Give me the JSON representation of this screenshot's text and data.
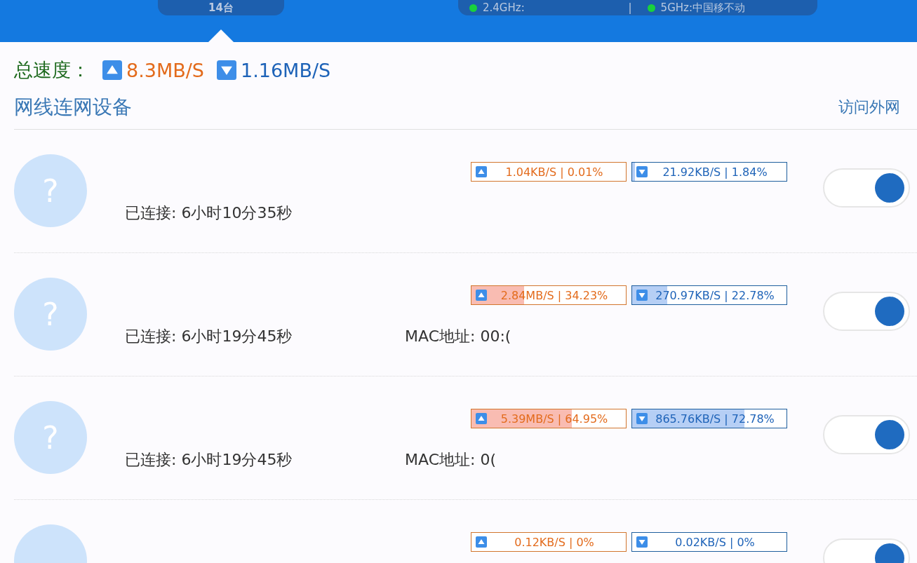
{
  "header": {
    "device_count": "14台",
    "wifi": [
      {
        "label": "2.4GHz:"
      },
      {
        "label": "5GHz:中国移不动"
      }
    ],
    "separator": "|"
  },
  "total_speed": {
    "label": "总速度：",
    "upload": "8.3MB/S",
    "download": "1.16MB/S"
  },
  "section": {
    "title": "网线连网设备",
    "action": "访问外网"
  },
  "devices": [
    {
      "avatar": "?",
      "upload": {
        "text": "1.04KB/S | 0.01%",
        "level": 0.0001
      },
      "download": {
        "text": "21.92KB/S | 1.84%",
        "level": 0.0184
      },
      "connected": "已连接: 6小时10分35秒",
      "on": true
    },
    {
      "avatar": "?",
      "upload": {
        "text": "2.84MB/S | 34.23%",
        "level": 0.3423
      },
      "download": {
        "text": "270.97KB/S | 22.78%",
        "level": 0.2278
      },
      "connected": "已连接: 6小时19分45秒",
      "mac": "MAC地址: 00:(",
      "on": true
    },
    {
      "avatar": "?",
      "upload": {
        "text": "5.39MB/S | 64.95%",
        "level": 0.6495
      },
      "download": {
        "text": "865.76KB/S | 72.78%",
        "level": 0.7278
      },
      "connected": "已连接: 6小时19分45秒",
      "mac": "MAC地址: 0(",
      "on": true
    },
    {
      "upload": {
        "text": "0.12KB/S | 0%",
        "level": 0
      },
      "download": {
        "text": "0.02KB/S | 0%",
        "level": 0
      },
      "on": true
    }
  ]
}
